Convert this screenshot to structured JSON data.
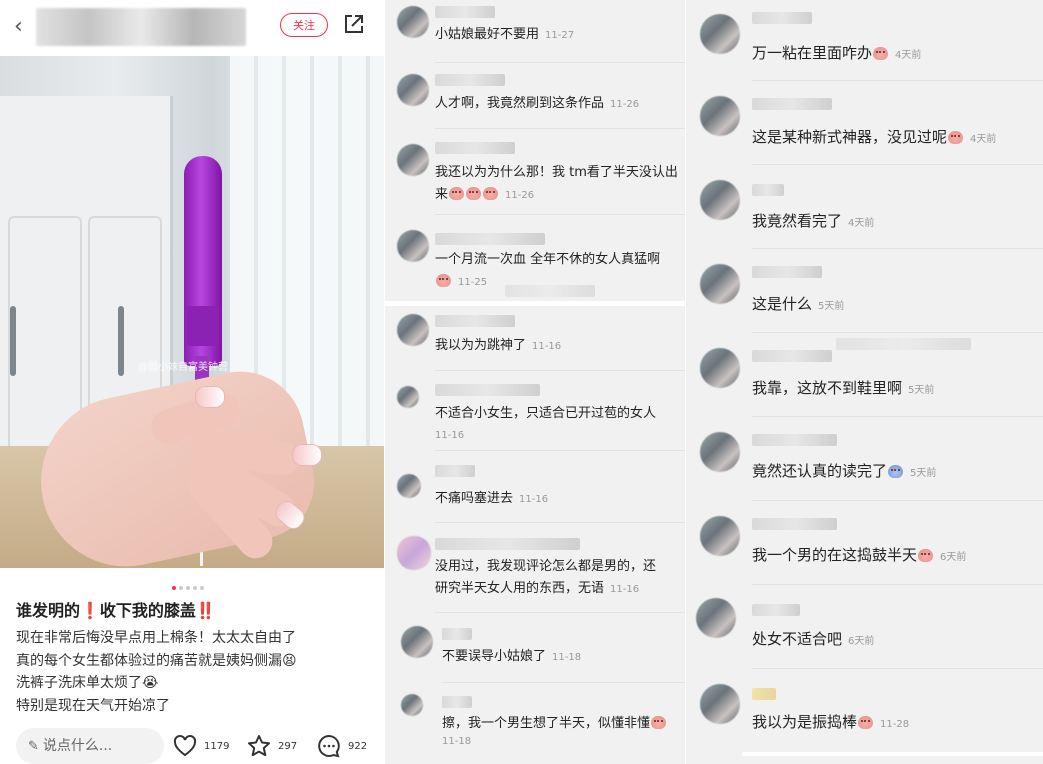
{
  "post": {
    "back_icon": "‹",
    "follow_label": "关注",
    "title": "谁发明的❗收下我的膝盖‼️",
    "body_lines": [
      "现在非常后悔没早点用上棉条！太太太自由了",
      "真的每个女生都体验过的痛苦就是姨妈侧漏😫",
      "洗裤子洗床单太烦了😭",
      "特别是现在天气开始凉了"
    ],
    "image_watermark": "@圆小妹自富美钟营",
    "carousel_index": 1,
    "carousel_total": 5,
    "comment_placeholder": "说点什么...",
    "likes": "1179",
    "favorites": "297",
    "comments": "922",
    "accent_color": "#ff2e4d"
  },
  "comments_left": [
    {
      "text": "小姑娘最好不要用",
      "time": "11-27"
    },
    {
      "text": "人才啊，我竟然刷到这条作品",
      "time": "11-26"
    },
    {
      "text": "我还以为为什么那！我 tm看了半天没认出",
      "text2": "来",
      "emoji": 3,
      "time": "11-26"
    },
    {
      "text": "一个月流一次血 全年不休的女人真猛啊",
      "emoji_line2": 1,
      "time": "11-25"
    },
    {
      "text": "我以为为跳神了",
      "time": "11-16"
    },
    {
      "text": "不适合小女生，只适合已开过苞的女人",
      "time": "11-16"
    },
    {
      "text": "不痛吗塞进去",
      "time": "11-16"
    },
    {
      "text": "没用过，我发现评论怎么都是男的，还",
      "text2": "研究半天女人用的东西，无语",
      "time": "11-16"
    },
    {
      "text": "不要误导小姑娘了",
      "time": "11-18"
    },
    {
      "text": "擦，我一个男生想了半天，似懂非懂",
      "emoji": 1,
      "time": "11-18"
    }
  ],
  "comments_right": [
    {
      "text": "万一粘在里面咋办",
      "emoji": 1,
      "time": "4天前"
    },
    {
      "text": "这是某种新式神器，没见过呢",
      "emoji": 1,
      "time": "4天前"
    },
    {
      "text": "我竟然看完了",
      "time": "4天前"
    },
    {
      "text": "这是什么",
      "time": "5天前"
    },
    {
      "text": "我靠，这放不到鞋里啊",
      "time": "5天前"
    },
    {
      "text": "竟然还认真的读完了",
      "emoji": 1,
      "time": "5天前"
    },
    {
      "text": "我一个男的在这捣鼓半天",
      "emoji": 1,
      "time": "6天前"
    },
    {
      "text": "处女不适合吧",
      "time": "6天前"
    },
    {
      "text": "我以为是振捣棒",
      "emoji": 1,
      "time": "11-28"
    }
  ]
}
